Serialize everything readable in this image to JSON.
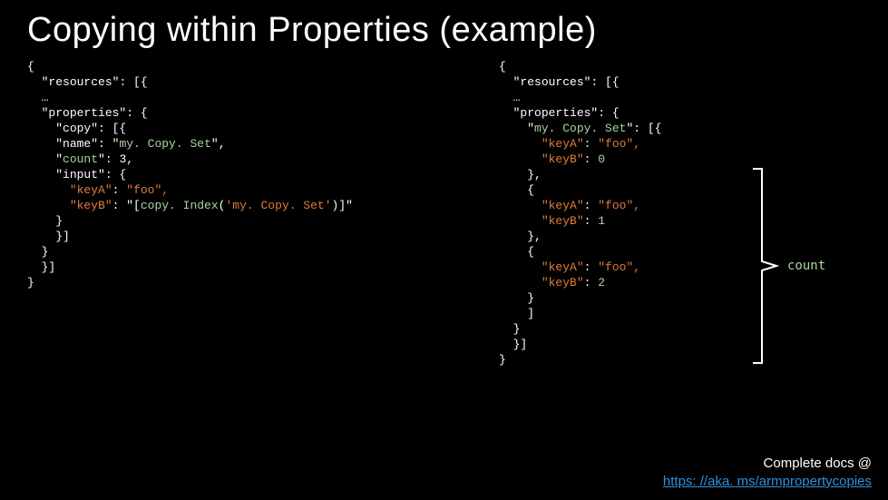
{
  "title": "Copying within Properties (example)",
  "left": {
    "l1": "{",
    "l2_a": "  ",
    "l2_b": "\"resources\"",
    "l2_c": ": [{",
    "l3": "  …",
    "l4_a": "  ",
    "l4_b": "\"properties\"",
    "l4_c": ": {",
    "l5_a": "    ",
    "l5_b": "\"copy\"",
    "l5_c": ": [{",
    "l6_a": "    ",
    "l6_b": "\"name\"",
    "l6_c": ": ",
    "l6_d": "\"",
    "l6_e": "my. Copy. Set",
    "l6_f": "\"",
    "l6_g": ",",
    "l7_a": "    ",
    "l7_b": "\"",
    "l7_c": "count",
    "l7_d": "\"",
    "l7_e": ": ",
    "l7_f": "3",
    "l7_g": ",",
    "l8_a": "    ",
    "l8_b": "\"input\"",
    "l8_c": ": {",
    "l9_a": "      ",
    "l9_b": "\"keyA\"",
    "l9_c": ": ",
    "l9_d": "\"foo\"",
    "l9_e": ",",
    "l10_a": "      ",
    "l10_b": "\"keyB\"",
    "l10_c": ": ",
    "l10_d": "\"[",
    "l10_e": "copy. Index",
    "l10_f": "(",
    "l10_g": "'my. Copy. Set'",
    "l10_h": ")]\"",
    "l11": "    }",
    "l12": "    }]",
    "l13": "  }",
    "l14": "  }]",
    "l15": "}"
  },
  "right": {
    "r1": "{",
    "r2_a": "  ",
    "r2_b": "\"resources\"",
    "r2_c": ": [{",
    "r3": "  …",
    "r4_a": "  ",
    "r4_b": "\"properties\"",
    "r4_c": ": {",
    "r5_a": "    ",
    "r5_b": "\"",
    "r5_c": "my. Copy. Set",
    "r5_d": "\"",
    "r5_e": ": [{",
    "r6_a": "      ",
    "r6_b": "\"keyA\"",
    "r6_c": ": ",
    "r6_d": "\"foo\"",
    "r6_e": ",",
    "r7_a": "      ",
    "r7_b": "\"keyB\"",
    "r7_c": ": ",
    "r7_d": "0",
    "r8": "    },",
    "r9": "    {",
    "r10_a": "      ",
    "r10_b": "\"keyA\"",
    "r10_c": ": ",
    "r10_d": "\"foo\"",
    "r10_e": ",",
    "r11_a": "      ",
    "r11_b": "\"keyB\"",
    "r11_c": ": ",
    "r11_d": "1",
    "r12": "    },",
    "r13": "    {",
    "r14_a": "      ",
    "r14_b": "\"keyA\"",
    "r14_c": ": ",
    "r14_d": "\"foo\"",
    "r14_e": ",",
    "r15_a": "      ",
    "r15_b": "\"keyB\"",
    "r15_c": ": ",
    "r15_d": "2",
    "r16": "    }",
    "r17": "    ]",
    "r18": "  }",
    "r19": "  }]",
    "r20": "}"
  },
  "annotation": {
    "count": "count"
  },
  "footer": {
    "text": "Complete docs @",
    "link": "https: //aka. ms/armpropertycopies"
  }
}
